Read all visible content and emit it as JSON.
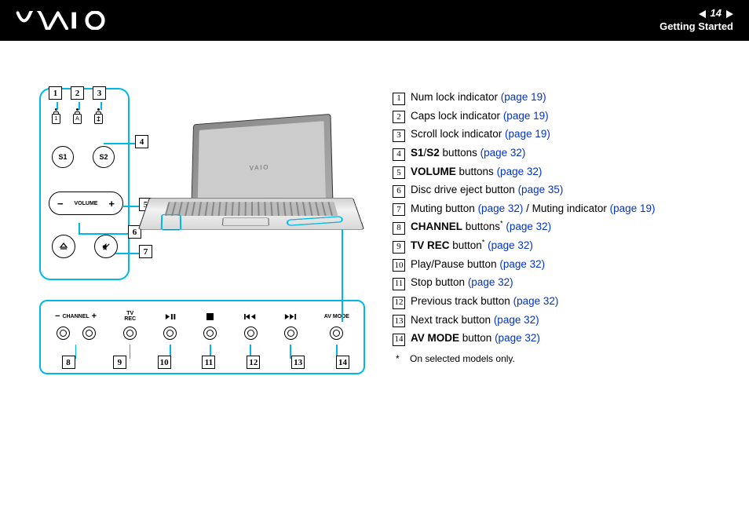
{
  "header": {
    "page_number": "14",
    "section_title": "Getting Started"
  },
  "side_panel": {
    "s1": "S1",
    "s2": "S2",
    "volume_label": "VOLUME",
    "ind1": "1",
    "ind2": "A",
    "indicator_callouts": [
      "1",
      "2",
      "3"
    ],
    "callout_4": "4",
    "callout_5": "5",
    "callout_6": "6",
    "callout_7": "7"
  },
  "bottom_panel": {
    "channel_label": "CHANNEL",
    "tv_rec_label": "TV\nREC",
    "av_mode_label": "AV MODE",
    "callouts": [
      "8",
      "9",
      "10",
      "11",
      "12",
      "13",
      "14"
    ]
  },
  "legend": [
    {
      "n": "1",
      "pre": "",
      "bold": "",
      "post": "Num lock indicator ",
      "link": "(page 19)"
    },
    {
      "n": "2",
      "pre": "",
      "bold": "",
      "post": "Caps lock indicator ",
      "link": "(page 19)"
    },
    {
      "n": "3",
      "pre": "",
      "bold": "",
      "post": "Scroll lock indicator ",
      "link": "(page 19)"
    },
    {
      "n": "4",
      "pre": "",
      "bold": "S1/S2",
      "post": " buttons ",
      "link": "(page 32)"
    },
    {
      "n": "5",
      "pre": "",
      "bold": "VOLUME",
      "post": " buttons ",
      "link": "(page 32)"
    },
    {
      "n": "6",
      "pre": "",
      "bold": "",
      "post": "Disc drive eject button ",
      "link": "(page 35)"
    },
    {
      "n": "7",
      "pre": "",
      "bold": "",
      "post": "Muting button ",
      "link": "(page 32)",
      "extra_text": " / Muting indicator ",
      "extra_link": "(page 19)"
    },
    {
      "n": "8",
      "pre": "",
      "bold": "CHANNEL",
      "post": " buttons",
      "sup": "*",
      "post2": " ",
      "link": "(page 32)"
    },
    {
      "n": "9",
      "pre": "",
      "bold": "TV REC",
      "post": " button",
      "sup": "*",
      "post2": " ",
      "link": "(page 32)"
    },
    {
      "n": "10",
      "pre": "",
      "bold": "",
      "post": "Play/Pause button ",
      "link": "(page 32)"
    },
    {
      "n": "11",
      "pre": "",
      "bold": "",
      "post": "Stop button ",
      "link": "(page 32)"
    },
    {
      "n": "12",
      "pre": "",
      "bold": "",
      "post": "Previous track button ",
      "link": "(page 32)"
    },
    {
      "n": "13",
      "pre": "",
      "bold": "",
      "post": "Next track button ",
      "link": "(page 32)"
    },
    {
      "n": "14",
      "pre": "",
      "bold": "AV MODE",
      "post": " button ",
      "link": "(page 32)"
    }
  ],
  "footnote": {
    "star": "*",
    "text": "On selected models only."
  },
  "icons": {
    "play_pause": "▶II",
    "stop": "■",
    "prev": "I◄◄",
    "next": "▶▶I",
    "eject": "⏏",
    "mute": "🔇",
    "minus": "−",
    "plus": "+"
  }
}
